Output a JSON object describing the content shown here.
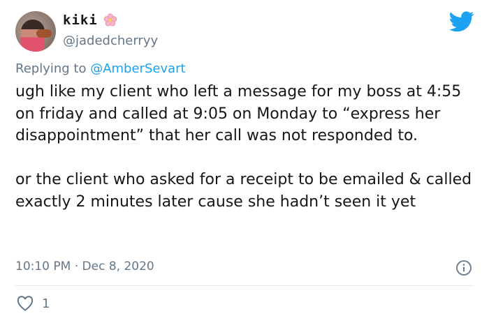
{
  "user": {
    "display_name": "kiki",
    "handle": "@jadedcherryy",
    "name_emoji": "cherry-blossom-icon"
  },
  "reply": {
    "prefix": "Replying to ",
    "to": "@AmberSevart"
  },
  "tweet": {
    "text": "ugh like my client who left a message for my boss at 4:55 on friday and called at 9:05 on Monday to “express her disappointment” that her call was not responded to.\n\nor the client who asked for a receipt to be emailed & called exactly 2 minutes later cause she hadn’t seen it yet",
    "timestamp": "10:10 PM · Dec 8, 2020",
    "likes": "1"
  },
  "icons": {
    "brand": "twitter-bird-icon",
    "info": "info-icon",
    "like": "heart-icon"
  },
  "colors": {
    "accent": "#1da1f2",
    "muted": "#657786",
    "text": "#14171a",
    "divider": "#e1e8ed"
  }
}
